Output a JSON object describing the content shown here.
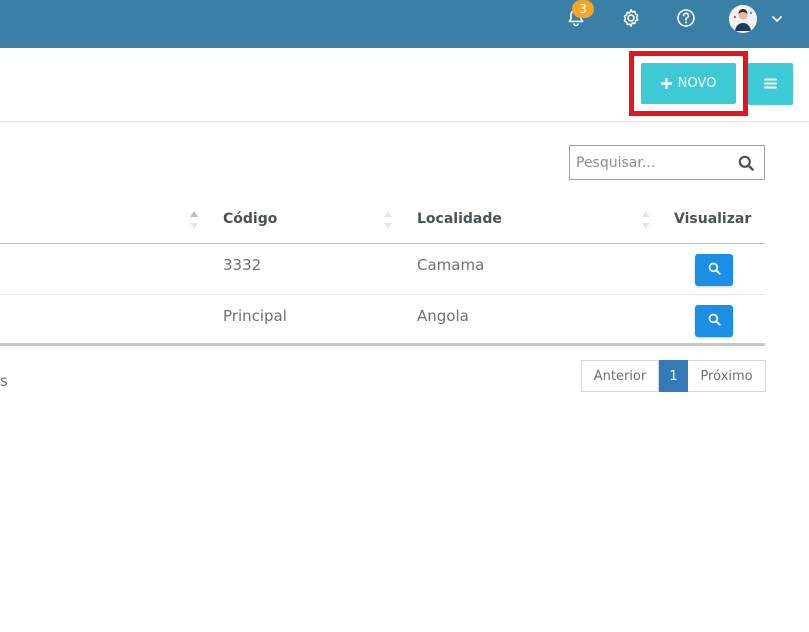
{
  "topbar": {
    "notification_count": "3",
    "icons": [
      "bell-icon",
      "gear-icon",
      "help-icon",
      "avatar",
      "chevron-down-icon"
    ],
    "background": "#3a7fa6"
  },
  "toolbar": {
    "new_label": "NOVO",
    "accent": "#3ec9d6",
    "highlight_color": "#e8141b"
  },
  "search": {
    "placeholder": "Pesquisar..."
  },
  "table": {
    "columns": [
      "Código",
      "Localidade",
      "Visualizar"
    ],
    "rows": [
      {
        "codigo": "3332",
        "localidade": "Camama"
      },
      {
        "codigo": "Principal",
        "localidade": "Angola"
      }
    ]
  },
  "footer": {
    "info_fragment": "s",
    "prev": "Anterior",
    "page": "1",
    "next": "Próximo"
  }
}
